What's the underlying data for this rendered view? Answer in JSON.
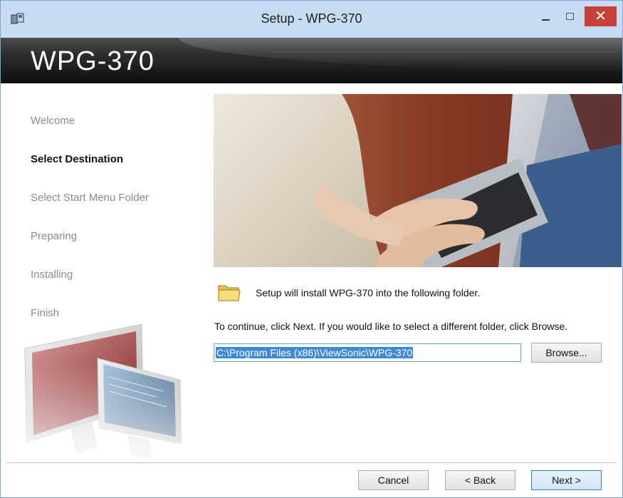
{
  "window": {
    "title": "Setup - WPG-370",
    "close_glyph": "✕"
  },
  "banner": {
    "product_name": "WPG-370"
  },
  "sidebar": {
    "items": [
      {
        "label": "Welcome",
        "active": false
      },
      {
        "label": "Select Destination",
        "active": true
      },
      {
        "label": "Select Start Menu Folder",
        "active": false
      },
      {
        "label": "Preparing",
        "active": false
      },
      {
        "label": "Installing",
        "active": false
      },
      {
        "label": "Finish",
        "active": false
      }
    ]
  },
  "main": {
    "info_text": "Setup will install WPG-370 into the following folder.",
    "continue_text": "To continue, click Next. If you would like to select a different folder, click Browse.",
    "path_value": "C:\\Program Files (x86)\\ViewSonic\\WPG-370",
    "browse_label": "Browse..."
  },
  "footer": {
    "cancel_label": "Cancel",
    "back_label": "< Back",
    "next_label": "Next >"
  },
  "icons": [
    "setup-app-icon",
    "folder-icon",
    "minimize-icon",
    "maximize-icon",
    "close-icon"
  ]
}
